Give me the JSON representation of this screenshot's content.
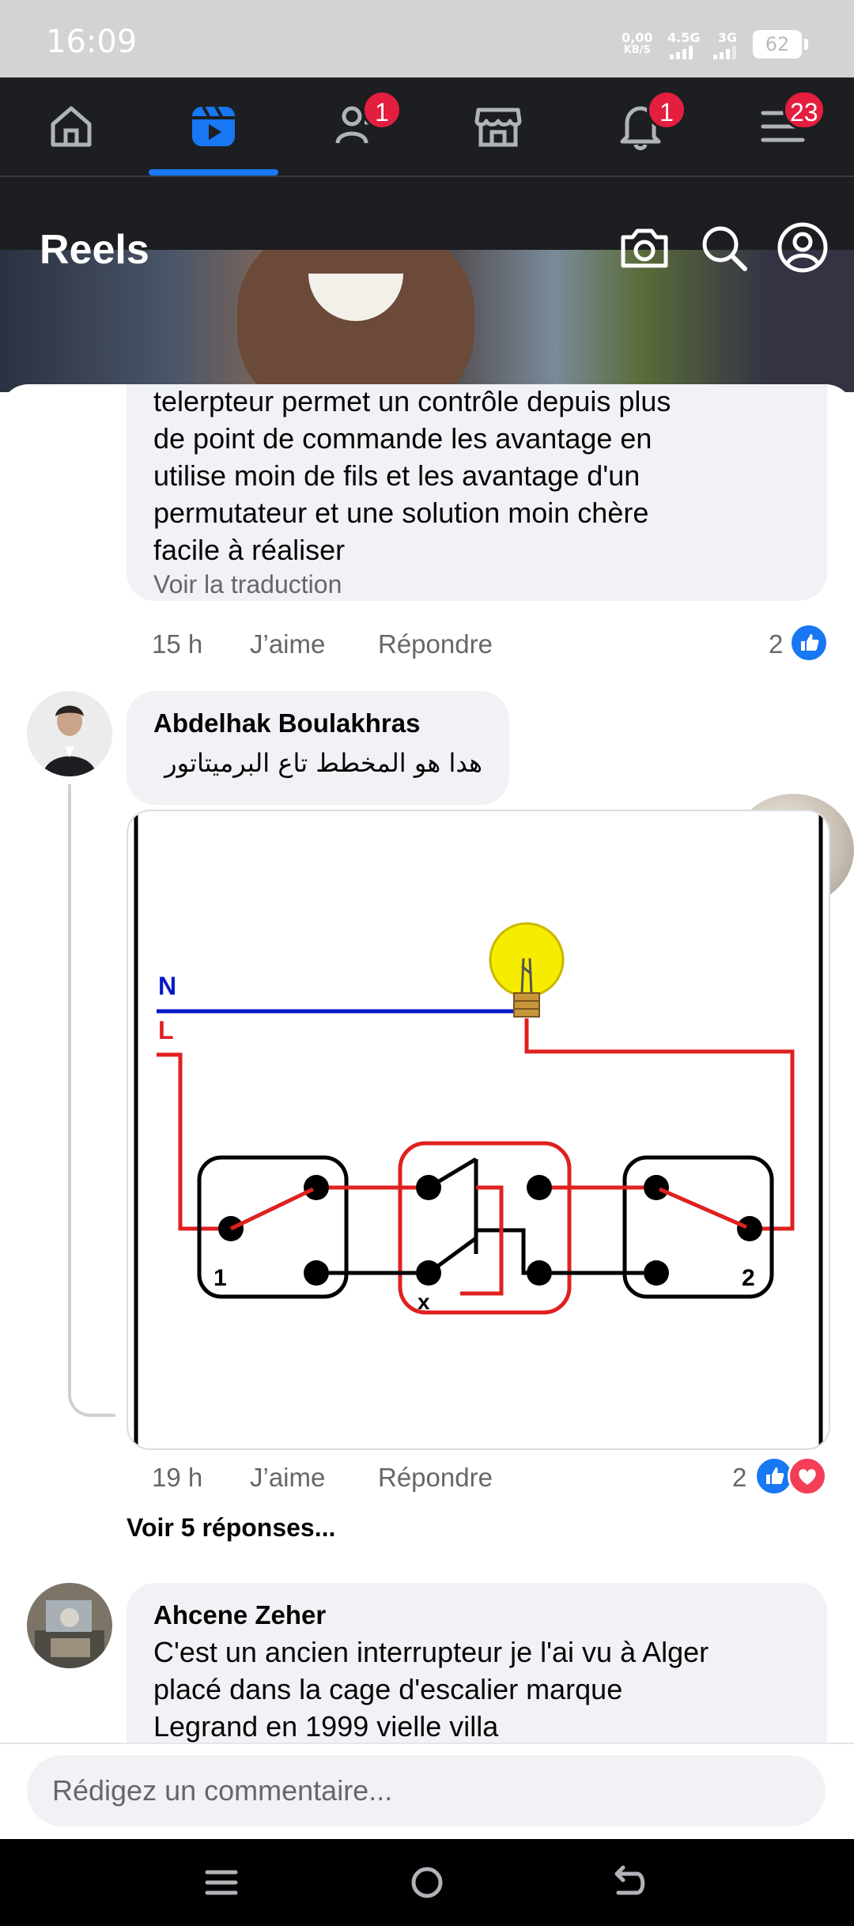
{
  "status_bar": {
    "time": "16:09",
    "speed_value": "0,00",
    "speed_unit": "KB/S",
    "network_1": "4.5G",
    "network_2": "3G",
    "battery": "62"
  },
  "nav": {
    "items": [
      {
        "name": "home",
        "icon": "home-icon"
      },
      {
        "name": "reels",
        "icon": "video-play-icon",
        "active": true
      },
      {
        "name": "friends",
        "icon": "friends-icon",
        "badge": "1"
      },
      {
        "name": "marketplace",
        "icon": "shop-icon"
      },
      {
        "name": "notifications",
        "icon": "bell-icon",
        "badge": "1"
      },
      {
        "name": "menu",
        "icon": "menu-icon",
        "badge": "23"
      }
    ],
    "accent": "#1877f2",
    "badge_color": "#e41e3f"
  },
  "reels_header": {
    "title": "Reels",
    "icons": [
      "camera-icon",
      "search-icon",
      "profile-icon"
    ]
  },
  "comments": [
    {
      "text_lines": [
        "telerpteur permet un contrôle depuis plus",
        "de point de commande les avantage en",
        "utilise moin de fils et les avantage d'un",
        "permutateur et une solution moin chère",
        "facile à réaliser"
      ],
      "translate_label": "Voir la traduction",
      "time": "15 h",
      "like_label": "J’aime",
      "reply_label": "Répondre",
      "reaction_count": "2"
    },
    {
      "author": "Abdelhak Boulakhras",
      "text": "هدا هو المخطط تاع البرميتاتور",
      "time": "19 h",
      "like_label": "J’aime",
      "reply_label": "Répondre",
      "reaction_count": "2",
      "more_replies": "Voir 5 réponses..."
    },
    {
      "author": "Ahcene Zeher",
      "text_lines": [
        "C'est un ancien interrupteur je l'ai vu à Alger",
        "placé dans la cage d'escalier marque",
        "Legrand en 1999 vielle villa"
      ]
    }
  ],
  "diagram": {
    "label_n": "N",
    "label_l": "L",
    "switch_1": "1",
    "switch_x": "x",
    "switch_2": "2",
    "neutral_color": "#0018c8",
    "live_color": "#e02020"
  },
  "composer": {
    "placeholder": "Rédigez un commentaire..."
  }
}
